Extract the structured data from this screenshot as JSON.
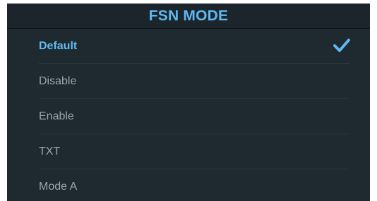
{
  "header": {
    "title": "FSN MODE"
  },
  "options": [
    {
      "label": "Default",
      "selected": true
    },
    {
      "label": "Disable",
      "selected": false
    },
    {
      "label": "Enable",
      "selected": false
    },
    {
      "label": "TXT",
      "selected": false
    },
    {
      "label": "Mode A",
      "selected": false
    }
  ],
  "selected_index": 0,
  "colors": {
    "panel_background": "#1f2930",
    "accent": "#5db8f2",
    "text_inactive": "#9aa5ac",
    "divider": "#2c373e"
  },
  "icons": {
    "selected_marker": "checkmark-icon"
  }
}
